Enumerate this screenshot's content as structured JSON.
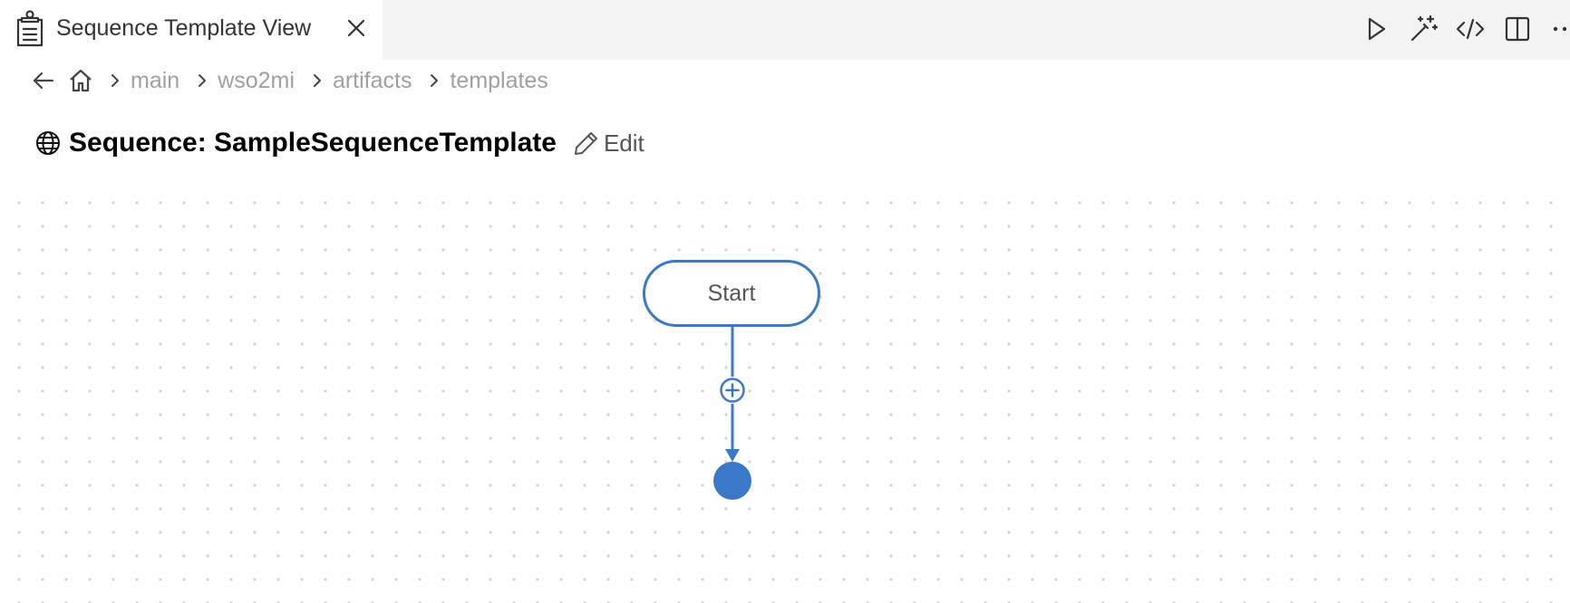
{
  "tab": {
    "title": "Sequence Template View",
    "icon": "clipboard-list-icon"
  },
  "toolbar": {
    "actions": [
      {
        "name": "run-icon"
      },
      {
        "name": "magic-wand-icon"
      },
      {
        "name": "code-icon"
      },
      {
        "name": "split-editor-icon"
      },
      {
        "name": "more-icon"
      }
    ]
  },
  "breadcrumb": {
    "items": [
      "main",
      "wso2mi",
      "artifacts",
      "templates"
    ]
  },
  "header": {
    "title": "Sequence: SampleSequenceTemplate",
    "edit_label": "Edit"
  },
  "diagram": {
    "start_label": "Start"
  },
  "colors": {
    "accent": "#3a78c9",
    "tabbar_bg": "#f3f3f3",
    "breadcrumb_text": "#a0a0a0"
  }
}
